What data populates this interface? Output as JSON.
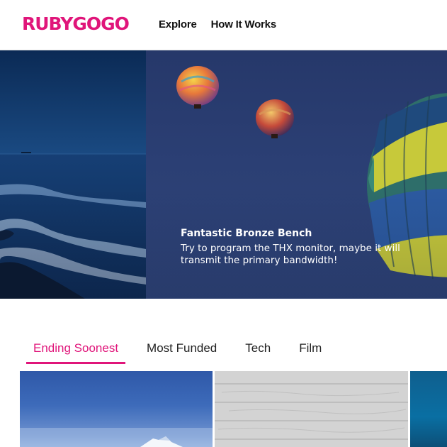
{
  "brand": {
    "name": "RUBYGOGO",
    "color": "#e0157a"
  },
  "nav": {
    "items": [
      {
        "label": "Explore"
      },
      {
        "label": "How It Works"
      }
    ]
  },
  "hero": {
    "title": "Fantastic Bronze Bench",
    "description": "Try to program the THX monitor, maybe it will transmit the primary bandwidth!"
  },
  "tabs": {
    "items": [
      {
        "label": "Ending Soonest",
        "active": true
      },
      {
        "label": "Most Funded",
        "active": false
      },
      {
        "label": "Tech",
        "active": false
      },
      {
        "label": "Film",
        "active": false
      }
    ]
  }
}
